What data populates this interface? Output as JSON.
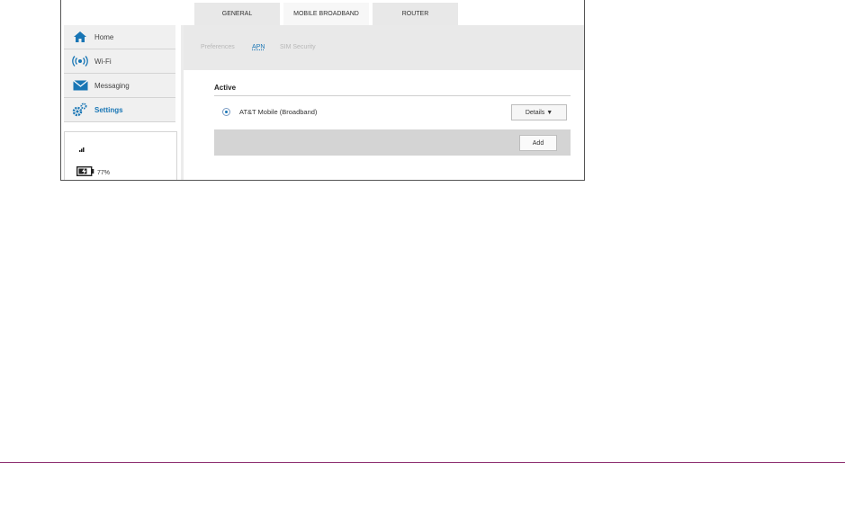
{
  "tabs": [
    {
      "label": "GENERAL"
    },
    {
      "label": "MOBILE BROADBAND"
    },
    {
      "label": "ROUTER"
    }
  ],
  "sidebar": {
    "items": [
      {
        "label": "Home",
        "icon": "home-icon"
      },
      {
        "label": "Wi-Fi",
        "icon": "wifi-icon"
      },
      {
        "label": "Messaging",
        "icon": "envelope-icon"
      },
      {
        "label": "Settings",
        "icon": "gear-icon"
      }
    ],
    "battery_text": "77%",
    "signal_icon": "signal-bars-icon"
  },
  "subtabs": [
    {
      "label": "Preferences"
    },
    {
      "label": "APN"
    },
    {
      "label": "SIM Security"
    }
  ],
  "apn": {
    "section_title": "Active",
    "entry_name": "AT&T Mobile (Broadband)",
    "details_label": "Details ▼",
    "add_label": "Add"
  },
  "colors": {
    "accent": "#1976b5",
    "footer_line": "#8a2a6d"
  }
}
